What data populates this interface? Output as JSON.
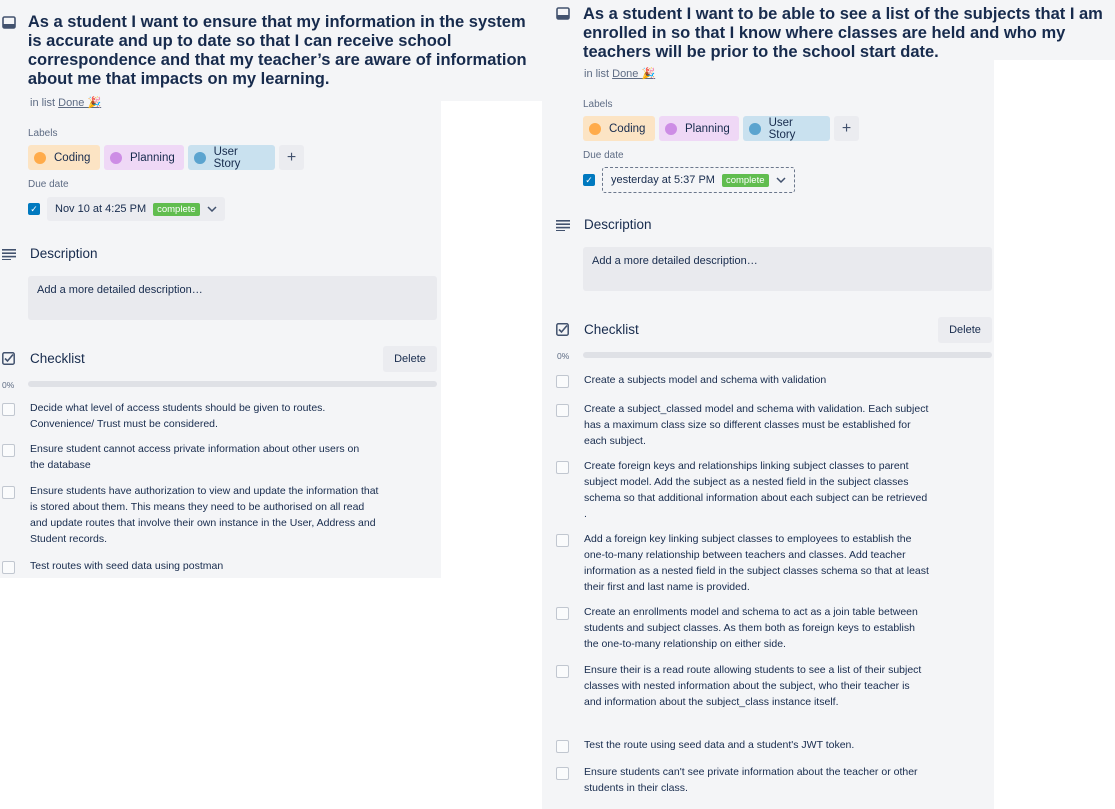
{
  "card_left": {
    "title": "As a student I want to ensure that my information in the system is accurate and up to date so that I can receive school correspondence and that my teacher’s are aware of information about me that impacts on my learning.",
    "in_list_prefix": "in list",
    "list_name": "Done 🎉",
    "labels_heading": "Labels",
    "labels": [
      {
        "name": "Coding",
        "color": "#ffab4a",
        "bg": "#fce4c4"
      },
      {
        "name": "Planning",
        "color": "#cd8de5",
        "bg": "#efd8f6"
      },
      {
        "name": "User Story",
        "color": "#5ba4cf",
        "bg": "#c9e1ef"
      }
    ],
    "add_label": "+",
    "due_heading": "Due date",
    "due_text": "Nov 10 at 4:25 PM",
    "due_status": "complete",
    "description_heading": "Description",
    "description_placeholder": "Add a more detailed description…",
    "checklist_heading": "Checklist",
    "delete_label": "Delete",
    "progress_text": "0%",
    "progress": 0,
    "items": [
      "Decide what level of access students should be given to routes. Convenience/ Trust must be considered.",
      "Ensure student cannot access private information about other users on the database",
      "Ensure students have authorization to view and update the information that is stored about them. This means they need to be authorised on all read and update routes that involve their own instance in the User, Address and Student records.",
      "Test routes with seed data using postman"
    ]
  },
  "card_right": {
    "title": "As a student I want to be able to see a list of the subjects that I am enrolled in so that I know where classes are held and who my teachers will be prior to the school start date.",
    "in_list_prefix": "in list",
    "list_name": "Done 🎉",
    "labels_heading": "Labels",
    "labels": [
      {
        "name": "Coding",
        "color": "#ffab4a",
        "bg": "#fce4c4"
      },
      {
        "name": "Planning",
        "color": "#cd8de5",
        "bg": "#efd8f6"
      },
      {
        "name": "User Story",
        "color": "#5ba4cf",
        "bg": "#c9e1ef"
      }
    ],
    "add_label": "+",
    "due_heading": "Due date",
    "due_text": "yesterday at 5:37 PM",
    "due_status": "complete",
    "description_heading": "Description",
    "description_placeholder": "Add a more detailed description…",
    "checklist_heading": "Checklist",
    "delete_label": "Delete",
    "progress_text": "0%",
    "progress": 0,
    "items": [
      "Create a subjects model and schema with validation",
      "Create a subject_classed model and schema with validation. Each subject has a maximum class size so different classes must be established for each subject.",
      "Create foreign keys and relationships linking subject classes to parent subject model. Add the subject as a nested field in the subject classes schema so that additional information about each subject can be retrieved .",
      "Add a foreign key linking subject classes to employees to establish the one-to-many relationship between teachers and classes. Add teacher information as a nested field in the subject classes schema so that at least their first and last name is provided.",
      "Create an enrollments model and schema to act as a join table between students and subject classes. As them both as foreign keys to establish the one-to-many relationship on either side.",
      "Ensure their is a read route allowing students to see a list of their subject classes with nested information about the subject, who their teacher is and information about the subject_class instance itself.",
      "Test the route using seed data and a student's JWT token.",
      "Ensure students can't see private information about the teacher or other students in their class."
    ]
  },
  "icons": {
    "card": "card-icon",
    "description": "description-icon",
    "checklist": "checklist-icon",
    "chevron": "chevron-down-icon",
    "check": "checkmark-icon"
  }
}
